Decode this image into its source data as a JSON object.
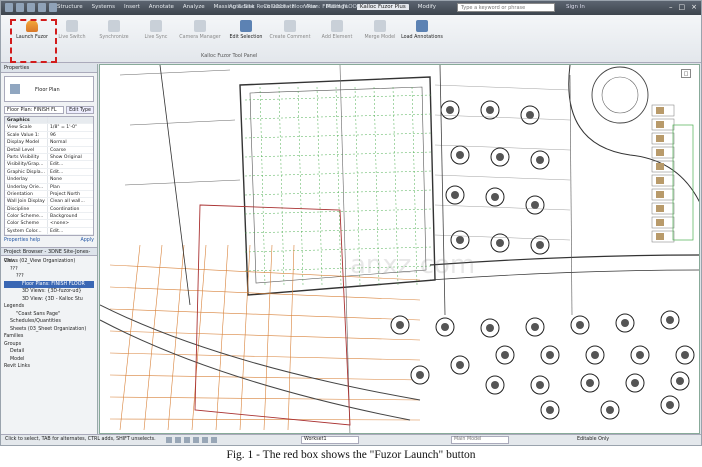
{
  "titlebar": {
    "menu_tabs": [
      "Structure",
      "Systems",
      "Insert",
      "Annotate",
      "Analyze",
      "Massing & Site",
      "Collaborate",
      "View",
      "Manage",
      "Kalloc Fuzor Plus",
      "Modify"
    ],
    "active_tab": "Kalloc Fuzor Plus",
    "window_title": "Autodesk Revit 2016 - Floor Plan: FINISH FLOOR",
    "search_placeholder": "Type a keyword or phrase",
    "sign_in": "Sign In"
  },
  "ribbon": {
    "buttons": [
      {
        "label": "Launch Fuzor",
        "enabled": true
      },
      {
        "label": "Live Switch",
        "enabled": false
      },
      {
        "label": "Synchronize",
        "enabled": false
      },
      {
        "label": "Live Sync",
        "enabled": false
      },
      {
        "label": "Camera Manager",
        "enabled": false
      },
      {
        "label": "Edit Selection",
        "enabled": true
      },
      {
        "label": "Create Comment",
        "enabled": false
      },
      {
        "label": "Add Element",
        "enabled": false
      },
      {
        "label": "Merge Model",
        "enabled": false
      },
      {
        "label": "Load Annotations",
        "enabled": true
      }
    ],
    "panel_label": "Kalloc Fuzor Tool Panel"
  },
  "properties": {
    "header": "Properties",
    "type": "Floor Plan",
    "instance": "Floor Plan: FINISH FL",
    "edit_type": "Edit Type",
    "rows": [
      {
        "k": "Graphics",
        "v": "",
        "group": true
      },
      {
        "k": "View Scale",
        "v": "1/8\" = 1'-0\""
      },
      {
        "k": "Scale Value 1:",
        "v": "96"
      },
      {
        "k": "Display Model",
        "v": "Normal"
      },
      {
        "k": "Detail Level",
        "v": "Coarse"
      },
      {
        "k": "Parts Visibility",
        "v": "Show Original"
      },
      {
        "k": "Visibility/Grap...",
        "v": "Edit..."
      },
      {
        "k": "Graphic Displa...",
        "v": "Edit..."
      },
      {
        "k": "Underlay",
        "v": "None"
      },
      {
        "k": "Underlay Orie...",
        "v": "Plan"
      },
      {
        "k": "Orientation",
        "v": "Project North"
      },
      {
        "k": "Wall Join Display",
        "v": "Clean all wall..."
      },
      {
        "k": "Discipline",
        "v": "Coordination"
      },
      {
        "k": "Color Scheme...",
        "v": "Background"
      },
      {
        "k": "Color Scheme",
        "v": "<none>"
      },
      {
        "k": "System Color...",
        "v": "Edit..."
      }
    ],
    "help_link": "Properties help",
    "apply": "Apply"
  },
  "browser": {
    "header": "Project Browser - 3DNE Site-Jones-Chi...",
    "items": [
      {
        "label": "Views (02_View Organization)",
        "indent": 0,
        "selected": false
      },
      {
        "label": "???",
        "indent": 1,
        "selected": false
      },
      {
        "label": "???",
        "indent": 2,
        "selected": false
      },
      {
        "label": "Floor Plans: FINISH FLOOR",
        "indent": 3,
        "selected": true
      },
      {
        "label": "3D Views: {3D-fuzor-ud}",
        "indent": 3,
        "selected": false
      },
      {
        "label": "3D View: {3D - Kalloc Stu",
        "indent": 3,
        "selected": false
      },
      {
        "label": "Legends",
        "indent": 0,
        "selected": false
      },
      {
        "label": "\"Coast Sans Page\"",
        "indent": 2,
        "selected": false
      },
      {
        "label": "Schedules/Quantities",
        "indent": 1,
        "selected": false
      },
      {
        "label": "Sheets (03_Sheet Organization)",
        "indent": 1,
        "selected": false
      },
      {
        "label": "Families",
        "indent": 0,
        "selected": false
      },
      {
        "label": "Groups",
        "indent": 0,
        "selected": false
      },
      {
        "label": "Detail",
        "indent": 1,
        "selected": false
      },
      {
        "label": "Model",
        "indent": 1,
        "selected": false
      },
      {
        "label": "Revit Links",
        "indent": 0,
        "selected": false
      }
    ]
  },
  "statusbar": {
    "message": "Click to select, TAB for alternates, CTRL adds, SHIFT unselects.",
    "workset": "Workset1",
    "main_model": "Main Model",
    "editable_only": "Editable Only"
  },
  "caption": "Fig. 1 - The red box shows the \"Fuzor Launch\" button",
  "watermark": "anxz.com",
  "colors": {
    "highlight": "#d21c1c",
    "accent": "#3a67b4"
  }
}
